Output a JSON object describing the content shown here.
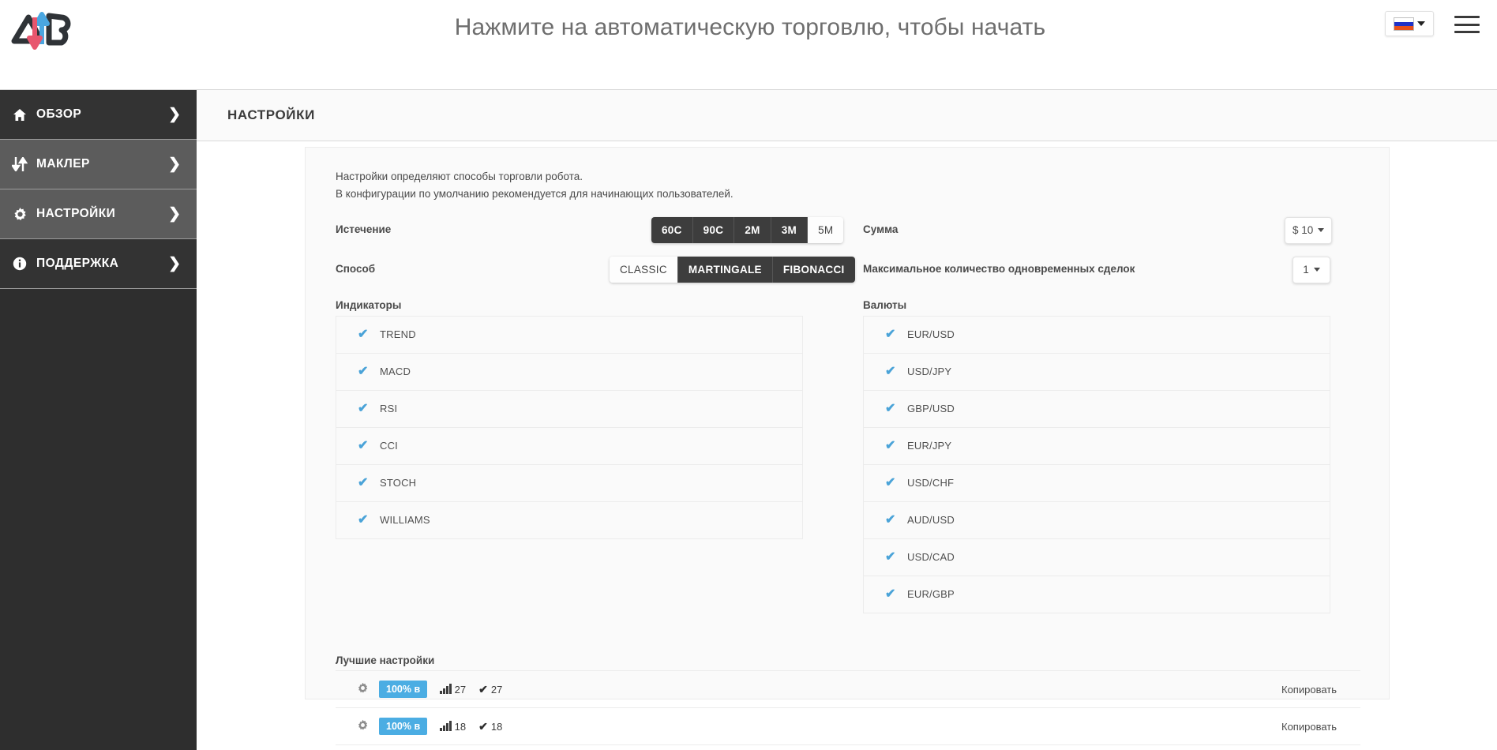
{
  "header": {
    "title": "Нажмите на автоматическую торговлю, чтобы начать",
    "logo_alt": "AB",
    "language": "RU",
    "menu_icon": "hamburger-icon"
  },
  "sidebar": {
    "items": [
      {
        "label": "ОБЗОР",
        "icon": "home-icon",
        "chevron": "❯"
      },
      {
        "label": "МАКЛЕР",
        "icon": "arrows-updown-icon",
        "chevron": "❯"
      },
      {
        "label": "НАСТРОЙКИ",
        "icon": "gear-icon",
        "chevron": "❯"
      },
      {
        "label": "ПОДДЕРЖКА",
        "icon": "info-icon",
        "chevron": "❯"
      }
    ]
  },
  "content": {
    "title": "НАСТРОЙКИ",
    "intro_line1": "Настройки определяют способы торговли робота.",
    "intro_line2": "В конфигурации по умолчанию рекомендуется для начинающих пользователей.",
    "settings": {
      "expiration": {
        "label": "Истечение",
        "options": [
          "60C",
          "90C",
          "2M",
          "3M",
          "5M"
        ],
        "selected": "5M"
      },
      "method": {
        "label": "Способ",
        "options": [
          "CLASSIC",
          "MARTINGALE",
          "FIBONACCI"
        ],
        "selected": "CLASSIC"
      },
      "amount": {
        "label": "Сумма",
        "value": "$ 10"
      },
      "max_trades": {
        "label": "Максимальное количество одновременных сделок",
        "value": "1"
      }
    },
    "indicators": {
      "title": "Индикаторы",
      "items": [
        {
          "label": "TREND",
          "checked": true
        },
        {
          "label": "MACD",
          "checked": true
        },
        {
          "label": "RSI",
          "checked": true
        },
        {
          "label": "CCI",
          "checked": true
        },
        {
          "label": "STOCH",
          "checked": true
        },
        {
          "label": "WILLIAMS",
          "checked": true
        }
      ]
    },
    "currencies": {
      "title": "Валюты",
      "items": [
        {
          "label": "EUR/USD",
          "checked": true
        },
        {
          "label": "USD/JPY",
          "checked": true
        },
        {
          "label": "GBP/USD",
          "checked": true
        },
        {
          "label": "EUR/JPY",
          "checked": true
        },
        {
          "label": "USD/CHF",
          "checked": true
        },
        {
          "label": "AUD/USD",
          "checked": true
        },
        {
          "label": "USD/CAD",
          "checked": true
        },
        {
          "label": "EUR/GBP",
          "checked": true
        }
      ]
    },
    "best_settings": {
      "title": "Лучшие настройки",
      "copy_label": "Копировать",
      "rows": [
        {
          "percent": "100% в",
          "trades": "27",
          "wins": "27"
        },
        {
          "percent": "100% в",
          "trades": "18",
          "wins": "18"
        }
      ]
    }
  },
  "colors": {
    "accent_blue": "#4bade3",
    "check_blue": "#4aa3d8",
    "sidebar_dark": "#333333",
    "sidebar_light": "#5c5c5c",
    "segment_dark": "#3d3d3d"
  }
}
